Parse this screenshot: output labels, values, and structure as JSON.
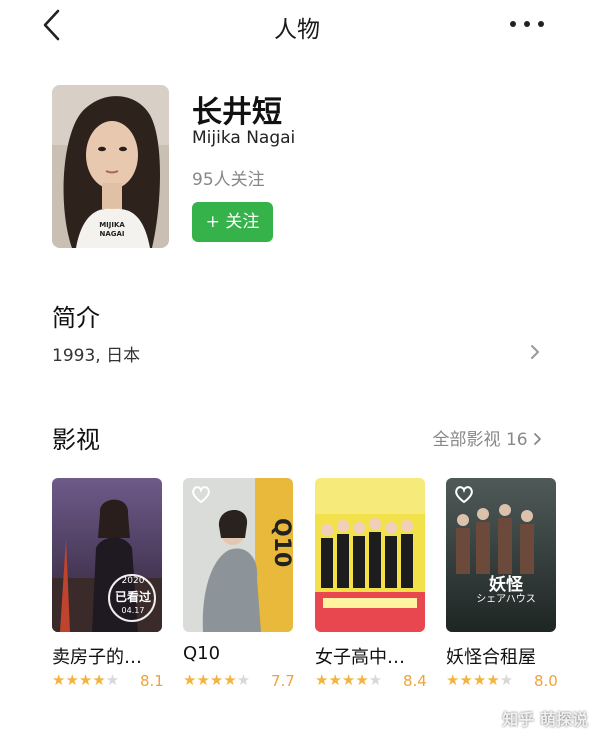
{
  "header": {
    "title": "人物"
  },
  "person": {
    "name": "长井短",
    "name_en": "Mijika Nagai",
    "followers": "95人关注",
    "follow_label": "+ 关注",
    "photo_caption": "MIJIKA NAGAI"
  },
  "intro": {
    "heading": "简介",
    "text": "1993, 日本"
  },
  "films": {
    "heading": "影视",
    "all_label": "全部影视",
    "all_count": "16",
    "items": [
      {
        "title": "卖房子的…",
        "score": "8.1",
        "stars": 4,
        "poster_stamp": "已看过",
        "poster_year": "2020",
        "poster_date": "04.17"
      },
      {
        "title": "Q10",
        "score": "7.7",
        "stars": 4
      },
      {
        "title": "女子高中…",
        "score": "8.4",
        "stars": 4
      },
      {
        "title": "妖怪合租屋",
        "score": "8.0",
        "stars": 4,
        "poster_text": "妖怪"
      }
    ]
  },
  "watermark": "知乎 萌探说",
  "colors": {
    "follow_green": "#36b24a",
    "star": "#f2b441",
    "score": "#f2a23a"
  }
}
